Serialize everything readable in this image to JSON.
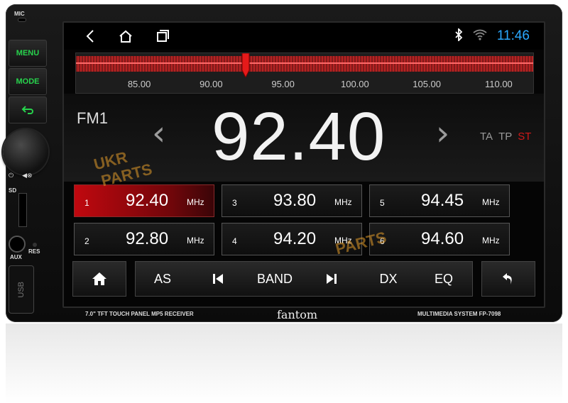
{
  "device": {
    "mic_label": "MIC",
    "buttons": {
      "menu": "MENU",
      "mode": "MODE"
    },
    "sd_label": "SD",
    "aux_label": "AUX",
    "res_label": "RES",
    "usb_label": "USB",
    "caption_left": "7.0\" TFT TOUCH PANEL MP5 RECEIVER",
    "brand": "fantom",
    "caption_right": "MULTIMEDIA SYSTEM FP-7098"
  },
  "status": {
    "time": "11:46"
  },
  "tuner": {
    "ticks": [
      "85.00",
      "90.00",
      "95.00",
      "100.00",
      "105.00",
      "110.00"
    ],
    "range": [
      80.6,
      112.4
    ],
    "needle_value": 92.4
  },
  "radio": {
    "band": "FM1",
    "frequency": "92.40",
    "flags": {
      "ta": "TA",
      "tp": "TP",
      "st": "ST"
    },
    "accent": "#d01818"
  },
  "presets": [
    {
      "num": "1",
      "freq": "92.40",
      "unit": "MHz",
      "active": true
    },
    {
      "num": "3",
      "freq": "93.80",
      "unit": "MHz",
      "active": false
    },
    {
      "num": "5",
      "freq": "94.45",
      "unit": "MHz",
      "active": false
    },
    {
      "num": "2",
      "freq": "92.80",
      "unit": "MHz",
      "active": false
    },
    {
      "num": "4",
      "freq": "94.20",
      "unit": "MHz",
      "active": false
    },
    {
      "num": "6",
      "freq": "94.60",
      "unit": "MHz",
      "active": false
    }
  ],
  "controls": {
    "as": "AS",
    "band": "BAND",
    "dx": "DX",
    "eq": "EQ"
  },
  "watermark": {
    "ukr": "UKR",
    "parts": "PARTS"
  },
  "icons": {
    "back": "back-chevron-icon",
    "home": "home-icon",
    "recents": "recents-icon",
    "bluetooth": "bluetooth-icon",
    "wifi": "wifi-icon"
  }
}
